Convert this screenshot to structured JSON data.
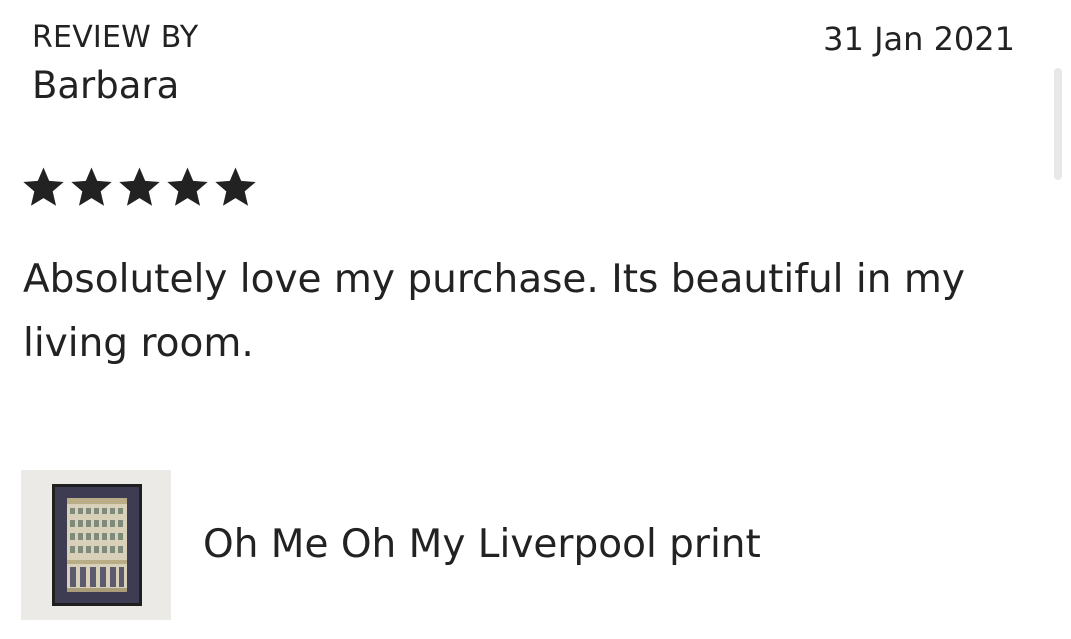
{
  "review": {
    "label": "REVIEW BY",
    "reviewer": "Barbara",
    "date": "31 Jan 2021",
    "rating": 5,
    "rating_max": 5,
    "text": "Absolutely love my purchase. Its beautiful in my living room."
  },
  "product": {
    "title": "Oh Me Oh My Liverpool print",
    "thumbnail_icon": "framed-building-print-image"
  },
  "icons": {
    "star": "star-icon"
  },
  "colors": {
    "text": "#222222",
    "star": "#222222",
    "thumb_background": "#eceae7",
    "scrollbar": "#e8e8e8"
  }
}
